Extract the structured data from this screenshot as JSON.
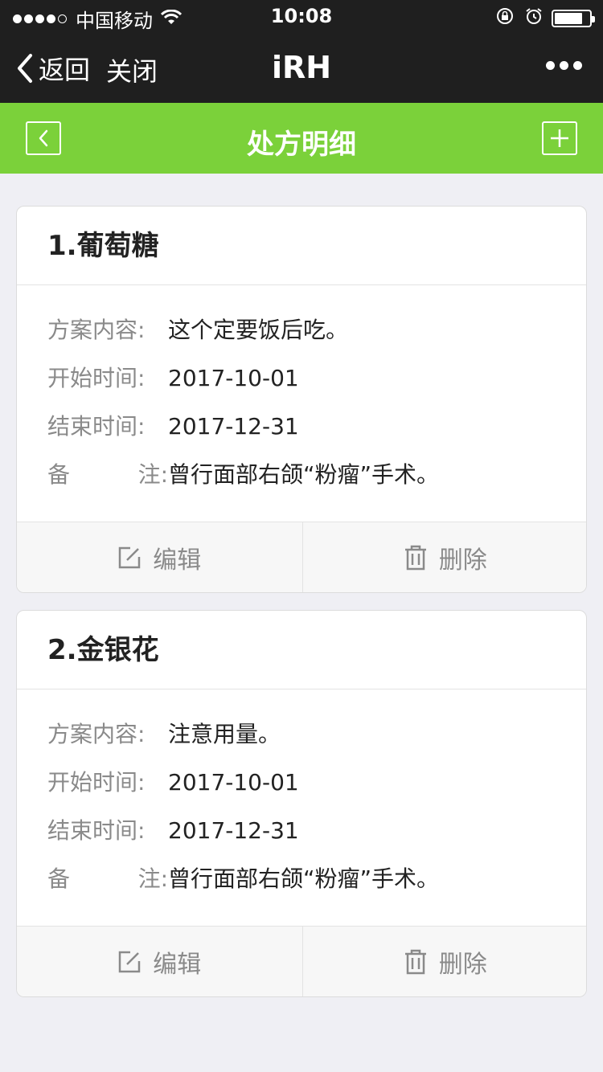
{
  "status_bar": {
    "carrier": "中国移动",
    "time": "10:08",
    "signal_strength": "4 of 5 bars"
  },
  "nav": {
    "back_label": "返回",
    "close_label": "关闭",
    "title": "iRH"
  },
  "header": {
    "title": "处方明细",
    "accent_color": "#7bd13a"
  },
  "labels": {
    "content": "方案内容:",
    "start": "开始时间:",
    "end": "结束时间:",
    "note_a": "备",
    "note_b": "注:",
    "edit": "编辑",
    "delete": "删除"
  },
  "prescriptions": [
    {
      "title": "1.葡萄糖",
      "content": "这个定要饭后吃。",
      "start": "2017-10-01",
      "end": "2017-12-31",
      "note": "曾行面部右颌“粉瘤”手术。"
    },
    {
      "title": "2.金银花",
      "content": "注意用量。",
      "start": "2017-10-01",
      "end": "2017-12-31",
      "note": "曾行面部右颌“粉瘤”手术。"
    }
  ]
}
